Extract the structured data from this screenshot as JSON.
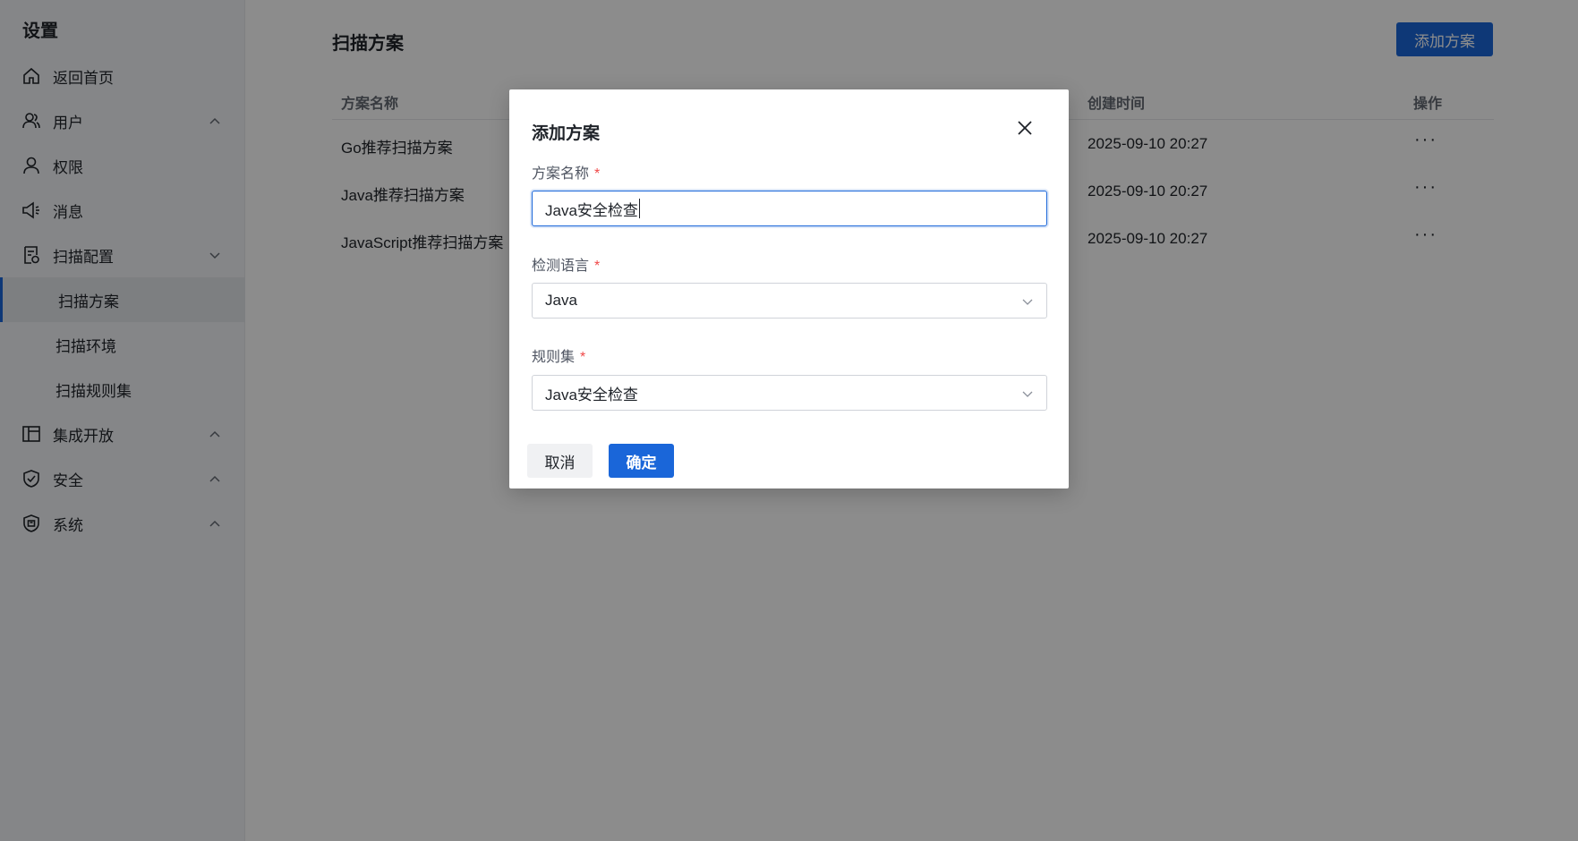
{
  "sidebar": {
    "title": "设置",
    "items": [
      {
        "label": "返回首页",
        "icon": "home-icon"
      },
      {
        "label": "用户",
        "icon": "users-icon",
        "chevron": "up"
      },
      {
        "label": "权限",
        "icon": "user-icon"
      },
      {
        "label": "消息",
        "icon": "megaphone-icon"
      },
      {
        "label": "扫描配置",
        "icon": "scan-doc-icon",
        "chevron": "down"
      },
      {
        "label": "集成开放",
        "icon": "layout-icon",
        "chevron": "up"
      },
      {
        "label": "安全",
        "icon": "shield-check-icon",
        "chevron": "up"
      },
      {
        "label": "系统",
        "icon": "shield-system-icon",
        "chevron": "up"
      }
    ],
    "sub_items": [
      "扫描方案",
      "扫描环境",
      "扫描规则集"
    ],
    "active_sub": "扫描方案"
  },
  "main": {
    "title": "扫描方案",
    "add_button": "添加方案",
    "columns": {
      "name": "方案名称",
      "time": "创建时间",
      "op": "操作"
    },
    "rows": [
      {
        "name": "Go推荐扫描方案",
        "time": "2025-09-10 20:27",
        "op": "···"
      },
      {
        "name": "Java推荐扫描方案",
        "time": "2025-09-10 20:27",
        "op": "···"
      },
      {
        "name": "JavaScript推荐扫描方案",
        "time": "2025-09-10 20:27",
        "op": "···"
      }
    ]
  },
  "modal": {
    "title": "添加方案",
    "name_label": "方案名称",
    "name_value": "Java安全检查",
    "language_label": "检测语言",
    "language_value": "Java",
    "ruleset_label": "规则集",
    "ruleset_value": "Java安全检查",
    "required_mark": "*",
    "cancel": "取消",
    "confirm": "确定"
  },
  "colors": {
    "primary": "#1a66d9",
    "required": "#f04848",
    "overlay": "rgba(0,0,0,0.45)"
  }
}
